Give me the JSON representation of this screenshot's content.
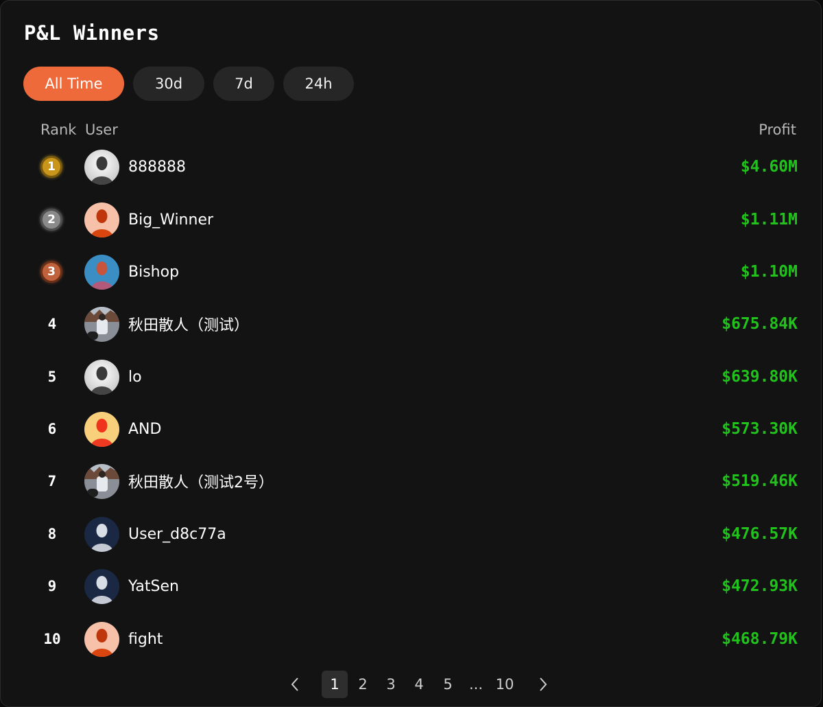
{
  "panel": {
    "title": "P&L Winners"
  },
  "tabs": [
    {
      "label": "All Time",
      "active": true
    },
    {
      "label": "30d"
    },
    {
      "label": "7d"
    },
    {
      "label": "24h"
    }
  ],
  "columns": {
    "rank": "Rank",
    "user": "User",
    "profit": "Profit"
  },
  "rows": [
    {
      "rank": "1",
      "medal": "gold",
      "name": "888888",
      "profit": "$4.60M",
      "avatar": "grey-silhouette"
    },
    {
      "rank": "2",
      "medal": "silver",
      "name": "Big_Winner",
      "profit": "$1.11M",
      "avatar": "orange-silhouette"
    },
    {
      "rank": "3",
      "medal": "bronze",
      "name": "Bishop",
      "profit": "$1.10M",
      "avatar": "blue-orange-silhouette"
    },
    {
      "rank": "4",
      "medal": "",
      "name": "秋田散人（测试）",
      "profit": "$675.84K",
      "avatar": "photo"
    },
    {
      "rank": "5",
      "medal": "",
      "name": "lo",
      "profit": "$639.80K",
      "avatar": "grey-silhouette"
    },
    {
      "rank": "6",
      "medal": "",
      "name": "AND",
      "profit": "$573.30K",
      "avatar": "red-yellow-silhouette"
    },
    {
      "rank": "7",
      "medal": "",
      "name": "秋田散人（测试2号）",
      "profit": "$519.46K",
      "avatar": "photo"
    },
    {
      "rank": "8",
      "medal": "",
      "name": "User_d8c77a",
      "profit": "$476.57K",
      "avatar": "navy-silhouette"
    },
    {
      "rank": "9",
      "medal": "",
      "name": "YatSen",
      "profit": "$472.93K",
      "avatar": "navy-silhouette"
    },
    {
      "rank": "10",
      "medal": "",
      "name": "fight",
      "profit": "$468.79K",
      "avatar": "orange-silhouette"
    }
  ],
  "pagination": {
    "prev_icon": "chevron-left-icon",
    "next_icon": "chevron-right-icon",
    "pages": [
      "1",
      "2",
      "3",
      "4",
      "5",
      "...",
      "10"
    ],
    "current": "1"
  },
  "colors": {
    "accent": "#ef6a3a",
    "profit": "#21c21c",
    "background": "#131313",
    "tab_inactive": "#262626"
  }
}
